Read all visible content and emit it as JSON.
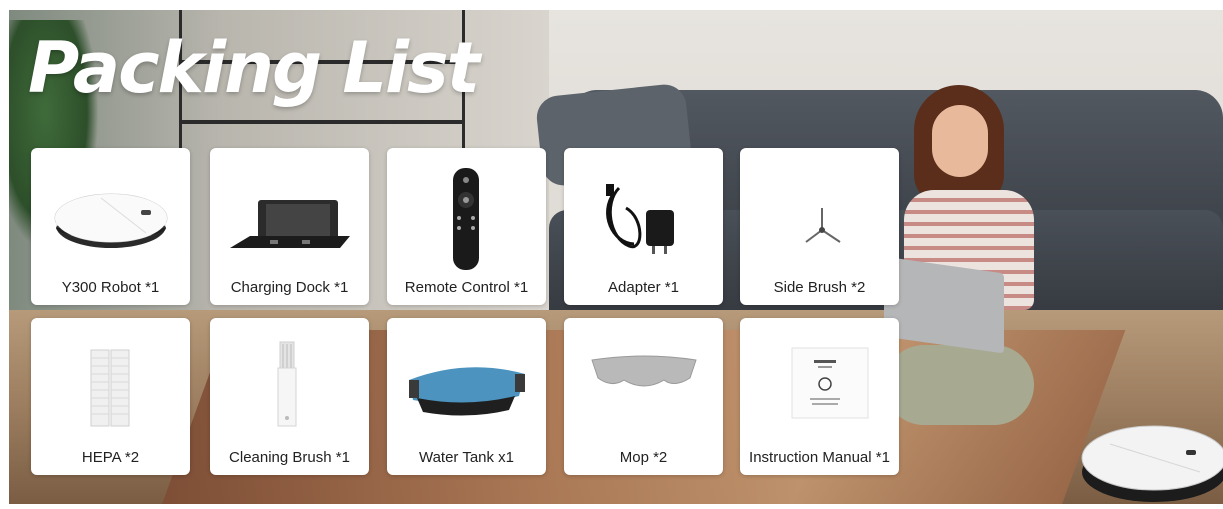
{
  "title": "Packing List",
  "items": [
    {
      "label": "Y300 Robot *1",
      "icon": "robot-vacuum-icon"
    },
    {
      "label": "Charging Dock *1",
      "icon": "charging-dock-icon"
    },
    {
      "label": "Remote Control *1",
      "icon": "remote-control-icon"
    },
    {
      "label": "Adapter *1",
      "icon": "power-adapter-icon"
    },
    {
      "label": "Side Brush *2",
      "icon": "side-brush-icon"
    },
    {
      "label": "HEPA *2",
      "icon": "hepa-filter-icon"
    },
    {
      "label": "Cleaning Brush *1",
      "icon": "cleaning-brush-icon"
    },
    {
      "label": "Water Tank x1",
      "icon": "water-tank-icon"
    },
    {
      "label": "Mop *2",
      "icon": "mop-pad-icon"
    },
    {
      "label": "Instruction Manual *1",
      "icon": "instruction-manual-icon"
    }
  ],
  "colors": {
    "title": "#ffffff",
    "card": "#ffffff",
    "label": "#222222"
  }
}
